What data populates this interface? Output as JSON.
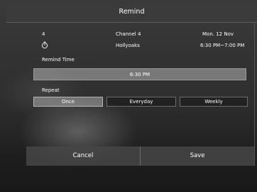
{
  "dialog": {
    "title": "Remind"
  },
  "program": {
    "channel_number": "4",
    "channel_name": "Channel 4",
    "date": "Mon. 12 Nov",
    "program_icon": "timer-icon",
    "program_title": "Hollyoaks",
    "time_range": "6:30 PM~7:00 PM"
  },
  "remind_time": {
    "label": "Remind Time",
    "value": "6:30 PM"
  },
  "repeat": {
    "label": "Repeat",
    "options": [
      {
        "label": "Once",
        "selected": true
      },
      {
        "label": "Everyday",
        "selected": false
      },
      {
        "label": "Weekly",
        "selected": false
      }
    ]
  },
  "footer": {
    "cancel_label": "Cancel",
    "save_label": "Save"
  },
  "colors": {
    "header_bg": "#3b3b3b",
    "selected_option_bg": "#8a8a8a",
    "time_field_bg": "#6e6e6e"
  }
}
